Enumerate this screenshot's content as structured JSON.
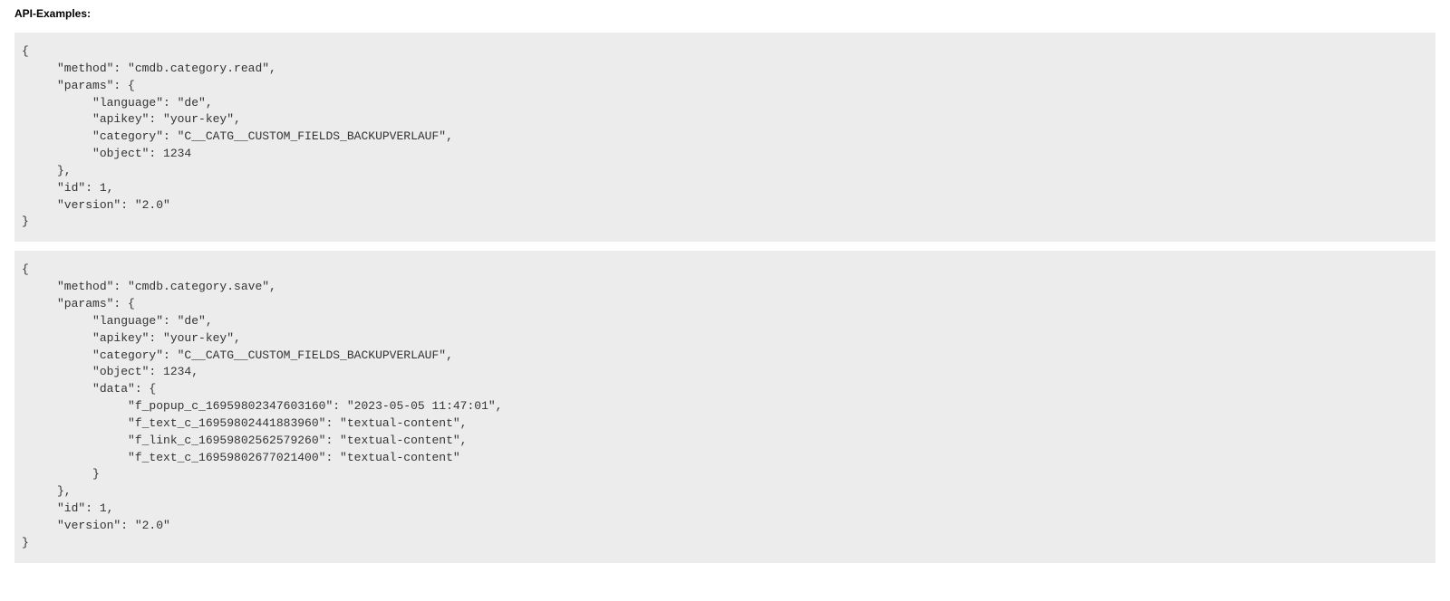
{
  "title": "API-Examples:",
  "examples": [
    "{\n     \"method\": \"cmdb.category.read\",\n     \"params\": {\n          \"language\": \"de\",\n          \"apikey\": \"your-key\",\n          \"category\": \"C__CATG__CUSTOM_FIELDS_BACKUPVERLAUF\",\n          \"object\": 1234\n     },\n     \"id\": 1,\n     \"version\": \"2.0\"\n}",
    "{\n     \"method\": \"cmdb.category.save\",\n     \"params\": {\n          \"language\": \"de\",\n          \"apikey\": \"your-key\",\n          \"category\": \"C__CATG__CUSTOM_FIELDS_BACKUPVERLAUF\",\n          \"object\": 1234,\n          \"data\": {\n               \"f_popup_c_16959802347603160\": \"2023-05-05 11:47:01\",\n               \"f_text_c_16959802441883960\": \"textual-content\",\n               \"f_link_c_16959802562579260\": \"textual-content\",\n               \"f_text_c_16959802677021400\": \"textual-content\"\n          }\n     },\n     \"id\": 1,\n     \"version\": \"2.0\"\n}"
  ]
}
